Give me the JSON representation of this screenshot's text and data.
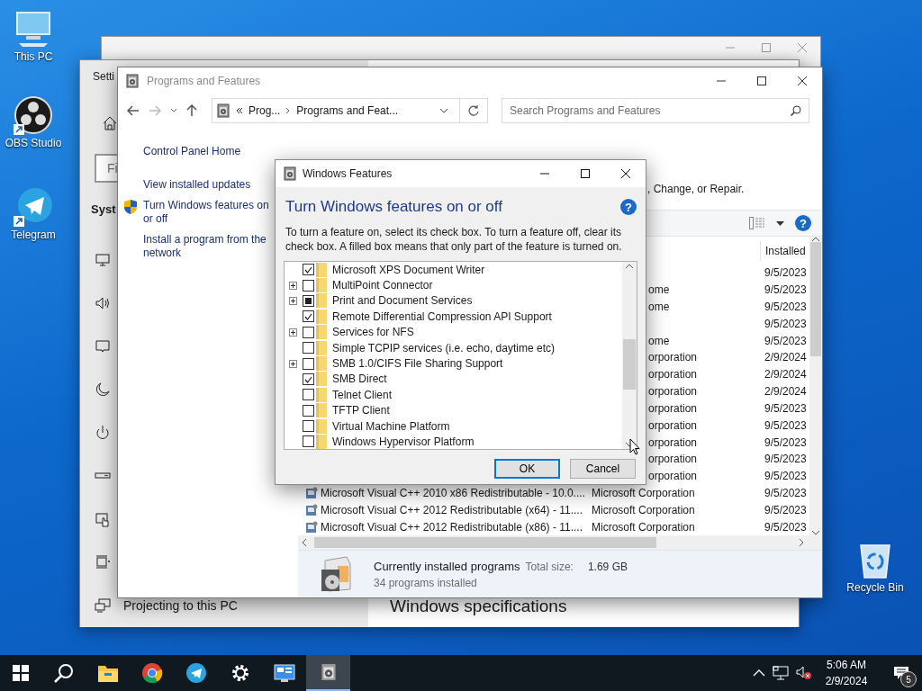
{
  "desktop_icons": [
    {
      "label": "This PC",
      "kind": "computer"
    },
    {
      "label": "OBS Studio",
      "kind": "obs"
    },
    {
      "label": "Telegram",
      "kind": "telegram"
    },
    {
      "label": "Recycle Bin",
      "kind": "recycle"
    }
  ],
  "settings_window": {
    "title": "Setti",
    "search_placeholder": "Fi",
    "section": "Syst",
    "nav_item": "Projecting to this PC",
    "content_heading": "Windows specifications"
  },
  "programs_window": {
    "title": "Programs and Features",
    "breadcrumb": [
      "Prog...",
      "Programs and Feat..."
    ],
    "search": {
      "placeholder": "Search Programs and Features"
    },
    "tasks": [
      {
        "label": "Control Panel Home",
        "shield": false
      },
      {
        "label": "View installed updates",
        "shield": false
      },
      {
        "label": "Turn Windows features on or off",
        "shield": true
      },
      {
        "label": "Install a program from the network",
        "shield": false
      }
    ],
    "subtitle": ", Change, or Repair.",
    "help": "?",
    "column": "Installed",
    "rows": [
      {
        "installed": "9/5/2023"
      },
      {
        "publisher": "ome",
        "installed": "9/5/2023"
      },
      {
        "publisher": "ome",
        "installed": "9/5/2023"
      },
      {
        "installed": "9/5/2023"
      },
      {
        "publisher": "ome",
        "installed": "9/5/2023"
      },
      {
        "publisher": "orporation",
        "installed": "2/9/2024"
      },
      {
        "publisher": "orporation",
        "installed": "2/9/2024"
      },
      {
        "publisher": "orporation",
        "installed": "2/9/2024"
      },
      {
        "publisher": "orporation",
        "installed": "9/5/2023"
      },
      {
        "publisher": "orporation",
        "installed": "9/5/2023"
      },
      {
        "publisher": "orporation",
        "installed": "9/5/2023"
      },
      {
        "publisher": "orporation",
        "installed": "9/5/2023"
      },
      {
        "publisher": "orporation",
        "installed": "9/5/2023"
      },
      {
        "name": "Microsoft Visual C++ 2010  x86 Redistributable - 10.0....",
        "publisher": "Microsoft Corporation",
        "installed": "9/5/2023"
      },
      {
        "name": "Microsoft Visual C++ 2012 Redistributable (x64) - 11....",
        "publisher": "Microsoft Corporation",
        "installed": "9/5/2023"
      },
      {
        "name": "Microsoft Visual C++ 2012 Redistributable (x86) - 11....",
        "publisher": "Microsoft Corporation",
        "installed": "9/5/2023"
      }
    ],
    "status": {
      "title": "Currently installed programs",
      "size_label": "Total size:",
      "size": "1.69 GB",
      "count": "34 programs installed"
    }
  },
  "dialog": {
    "title": "Windows Features",
    "heading": "Turn Windows features on or off",
    "help": "?",
    "description": "To turn a feature on, select its check box. To turn a feature off, clear its check box. A filled box means that only part of the feature is turned on.",
    "features": [
      {
        "label": "Microsoft XPS Document Writer",
        "expandable": false,
        "checked": true,
        "partial": false
      },
      {
        "label": "MultiPoint Connector",
        "expandable": true,
        "checked": false,
        "partial": false
      },
      {
        "label": "Print and Document Services",
        "expandable": true,
        "checked": false,
        "partial": true
      },
      {
        "label": "Remote Differential Compression API Support",
        "expandable": false,
        "checked": true,
        "partial": false
      },
      {
        "label": "Services for NFS",
        "expandable": true,
        "checked": false,
        "partial": false
      },
      {
        "label": "Simple TCPIP services (i.e. echo, daytime etc)",
        "expandable": false,
        "checked": false,
        "partial": false
      },
      {
        "label": "SMB 1.0/CIFS File Sharing Support",
        "expandable": true,
        "checked": false,
        "partial": false
      },
      {
        "label": "SMB Direct",
        "expandable": false,
        "checked": true,
        "partial": false
      },
      {
        "label": "Telnet Client",
        "expandable": false,
        "checked": false,
        "partial": false
      },
      {
        "label": "TFTP Client",
        "expandable": false,
        "checked": false,
        "partial": false
      },
      {
        "label": "Virtual Machine Platform",
        "expandable": false,
        "checked": false,
        "partial": false
      },
      {
        "label": "Windows Hypervisor Platform",
        "expandable": false,
        "checked": false,
        "partial": false
      }
    ],
    "buttons": [
      {
        "label": "OK",
        "kind": "default"
      },
      {
        "label": "Cancel",
        "kind": "normal"
      }
    ]
  },
  "taskbar": {
    "apps": [
      {
        "kind": "start",
        "active": false
      },
      {
        "kind": "search",
        "active": false
      },
      {
        "kind": "explorer",
        "active": false
      },
      {
        "kind": "chrome",
        "active": false
      },
      {
        "kind": "telegram",
        "active": false
      },
      {
        "kind": "settings",
        "active": false
      },
      {
        "kind": "control",
        "active": false
      },
      {
        "kind": "programs",
        "active": true
      }
    ],
    "time": "5:06 AM",
    "date": "2/9/2024",
    "notifications": "5"
  }
}
